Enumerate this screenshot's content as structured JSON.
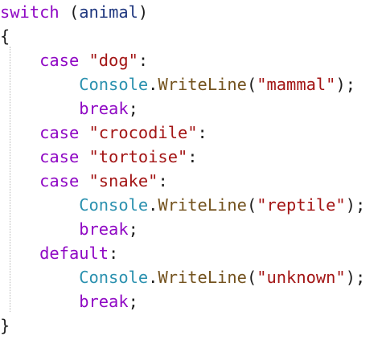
{
  "code": {
    "line1": {
      "kw": "switch",
      "open": " (",
      "ident": "animal",
      "close": ")"
    },
    "line2": {
      "brace": "{"
    },
    "line3": {
      "indent": "    ",
      "kw": "case",
      "space": " ",
      "str": "\"dog\"",
      "colon": ":"
    },
    "line4": {
      "indent": "        ",
      "type": "Console",
      "dot": ".",
      "method": "WriteLine",
      "open": "(",
      "str": "\"mammal\"",
      "close": ");"
    },
    "line5": {
      "indent": "        ",
      "kw": "break",
      "semi": ";"
    },
    "line6": {
      "indent": "    ",
      "kw": "case",
      "space": " ",
      "str": "\"crocodile\"",
      "colon": ":"
    },
    "line7": {
      "indent": "    ",
      "kw": "case",
      "space": " ",
      "str": "\"tortoise\"",
      "colon": ":"
    },
    "line8": {
      "indent": "    ",
      "kw": "case",
      "space": " ",
      "str": "\"snake\"",
      "colon": ":"
    },
    "line9": {
      "indent": "        ",
      "type": "Console",
      "dot": ".",
      "method": "WriteLine",
      "open": "(",
      "str": "\"reptile\"",
      "close": ");"
    },
    "line10": {
      "indent": "        ",
      "kw": "break",
      "semi": ";"
    },
    "line11": {
      "indent": "    ",
      "kw": "default",
      "colon": ":"
    },
    "line12": {
      "indent": "        ",
      "type": "Console",
      "dot": ".",
      "method": "WriteLine",
      "open": "(",
      "str": "\"unknown\"",
      "close": ");"
    },
    "line13": {
      "indent": "        ",
      "kw": "break",
      "semi": ";"
    },
    "line14": {
      "brace": "}"
    }
  },
  "colors": {
    "control_keyword": "#8f08c4",
    "string": "#a31515",
    "type": "#2b91af",
    "method": "#74531f",
    "identifier": "#1f377f",
    "plain": "#1e1e1e",
    "background": "#ffffff"
  }
}
